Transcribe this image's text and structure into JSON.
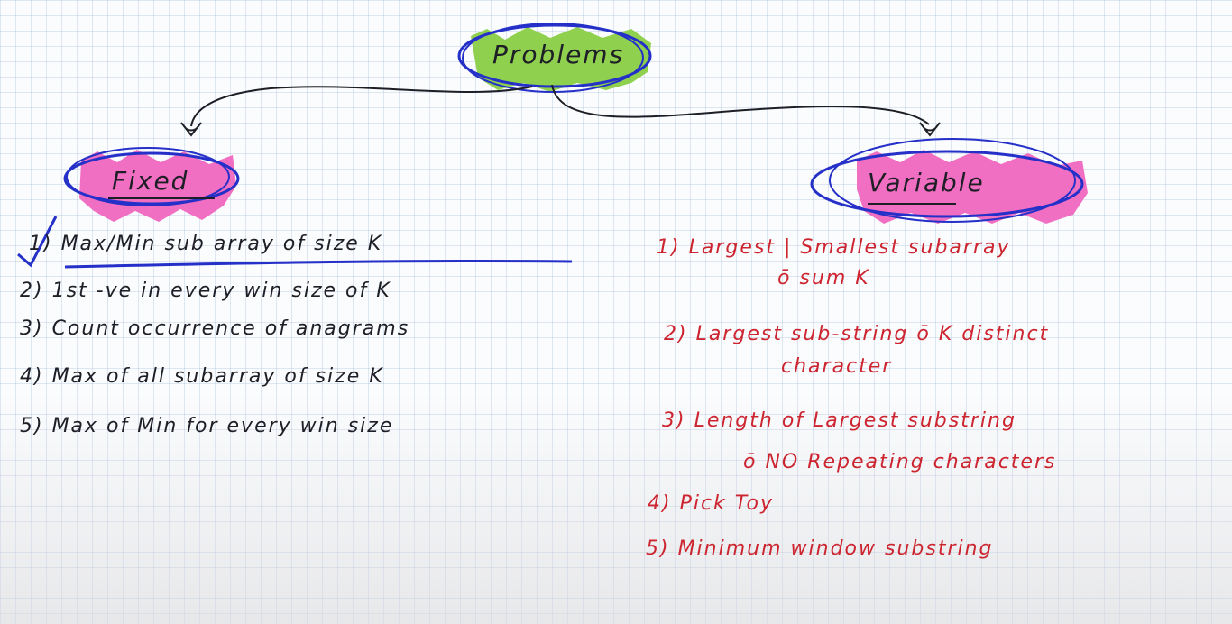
{
  "root": {
    "label": "Problems",
    "fill": "#8fd14f",
    "ring": "#2530c8"
  },
  "branches": {
    "fixed": {
      "label": "Fixed",
      "fill": "#f16fc2",
      "items": [
        "1) Max/Min sub array of size K",
        "2) 1st -ve in every win size of K",
        "3) Count occurrence of anagrams",
        "4) Max of all subarray of size K",
        "5) Max of Min for every win size"
      ]
    },
    "variable": {
      "label": "Variable",
      "fill": "#f16fc2",
      "items": [
        {
          "line1": "1) Largest | Smallest subarray",
          "line2": "ō sum K"
        },
        {
          "line1": "2) Largest sub-string ō K distinct",
          "line2": "character"
        },
        {
          "line1": "3) Length of Largest substring",
          "line2": "ō NO Repeating characters"
        },
        {
          "line1": "4) Pick Toy",
          "line2": ""
        },
        {
          "line1": "5) Minimum window substring",
          "line2": ""
        }
      ]
    }
  },
  "colors": {
    "ink": "#1e1e26",
    "red_ink": "#cc2530",
    "blue_pen": "#2530c8"
  }
}
